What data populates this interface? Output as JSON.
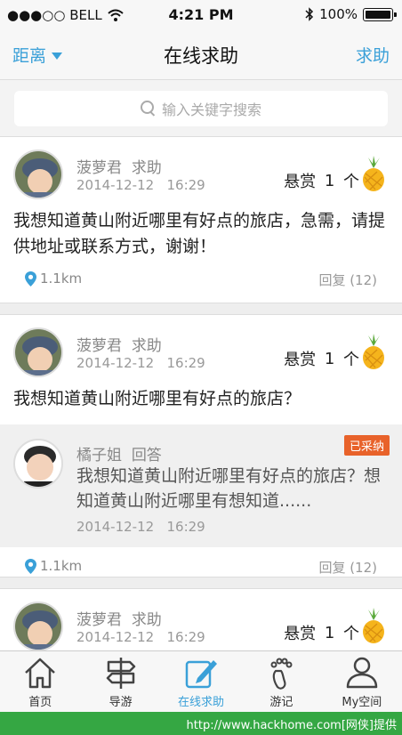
{
  "status_bar": {
    "carrier": "●●●○○ BELL",
    "time": "4:21 PM",
    "battery": "100%"
  },
  "nav": {
    "left_label": "距离",
    "title": "在线求助",
    "right_label": "求助"
  },
  "search": {
    "placeholder": "输入关键字搜索"
  },
  "posts": [
    {
      "user": "菠萝君",
      "action": "求助",
      "date": "2014-12-12",
      "time": "16:29",
      "reward_label": "悬赏",
      "reward_count": "1",
      "reward_unit": "个",
      "question": "我想知道黄山附近哪里有好点的旅店，急需，请提供地址或联系方式，谢谢！",
      "distance": "1.1km",
      "reply": "回复 (12)"
    },
    {
      "user": "菠萝君",
      "action": "求助",
      "date": "2014-12-12",
      "time": "16:29",
      "reward_label": "悬赏",
      "reward_count": "1",
      "reward_unit": "个",
      "question": "我想知道黄山附近哪里有好点的旅店？",
      "answer": {
        "user": "橘子姐",
        "action": "回答",
        "badge": "已采纳",
        "text": "我想知道黄山附近哪里有好点的旅店？想知道黄山附近哪里有想知道......",
        "date": "2014-12-12",
        "time": "16:29"
      },
      "distance": "1.1km",
      "reply": "回复 (12)"
    },
    {
      "user": "菠萝君",
      "action": "求助",
      "date": "2014-12-12",
      "time": "16:29",
      "reward_label": "悬赏",
      "reward_count": "1",
      "reward_unit": "个"
    }
  ],
  "tabs": [
    {
      "label": "首页",
      "icon": "home-icon",
      "active": false
    },
    {
      "label": "导游",
      "icon": "signpost-icon",
      "active": false
    },
    {
      "label": "在线求助",
      "icon": "edit-icon",
      "active": true
    },
    {
      "label": "游记",
      "icon": "footprint-icon",
      "active": false
    },
    {
      "label": "My空间",
      "icon": "user-icon",
      "active": false
    }
  ],
  "colors": {
    "accent": "#3aa0d8",
    "badge": "#e8622a",
    "watermark_bg": "#35a743"
  },
  "watermark": "http://www.hackhome.com[网侠]提供"
}
